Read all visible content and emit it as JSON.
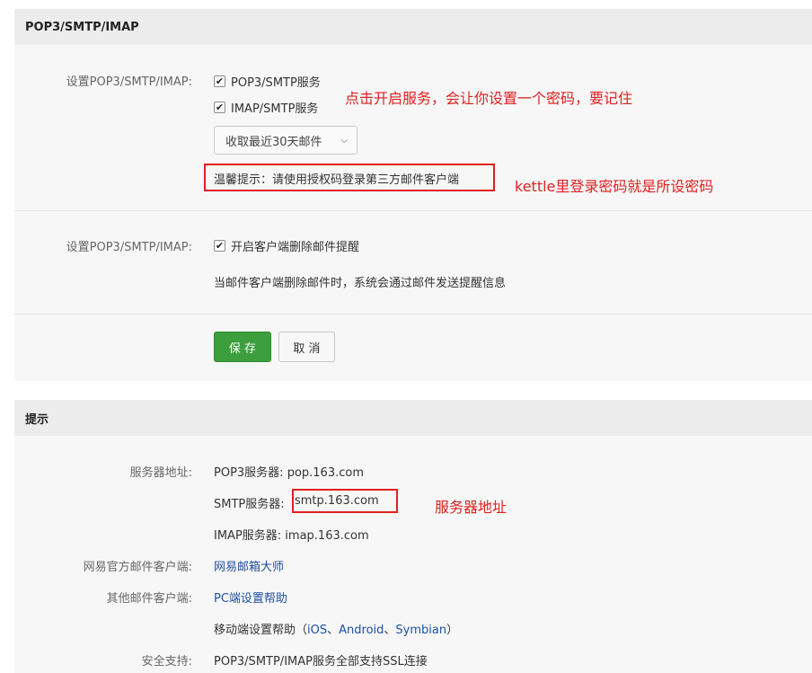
{
  "section1": {
    "title": "POP3/SMTP/IMAP",
    "row1_label": "设置POP3/SMTP/IMAP:",
    "pop3_label": "POP3/SMTP服务",
    "imap_label": "IMAP/SMTP服务",
    "select_value": "收取最近30天邮件",
    "tip_text": "温馨提示：请使用授权码登录第三方邮件客户端",
    "row2_label": "设置POP3/SMTP/IMAP:",
    "delete_alert_label": "开启客户端删除邮件提醒",
    "delete_alert_desc": "当邮件客户端删除邮件时，系统会通过邮件发送提醒信息",
    "save_label": "保 存",
    "cancel_label": "取 消"
  },
  "section2": {
    "title": "提示",
    "server_label": "服务器地址:",
    "pop3_server": "POP3服务器: pop.163.com",
    "smtp_prefix": "SMTP服务器:",
    "smtp_server": "smtp.163.com",
    "imap_server": "IMAP服务器: imap.163.com",
    "official_label": "网易官方邮件客户端:",
    "official_link": "网易邮箱大师",
    "other_label": "其他邮件客户端:",
    "pc_help": "PC端设置帮助",
    "mobile_prefix": "移动端设置帮助（",
    "mobile_ios": "iOS",
    "mobile_sep1": "、",
    "mobile_android": "Android",
    "mobile_sep2": "、",
    "mobile_symbian": "Symbian",
    "mobile_suffix": "）",
    "security_label": "安全支持:",
    "security_text": "POP3/SMTP/IMAP服务全部支持SSL连接"
  },
  "annotations": {
    "enable_note": "点击开启服务，会让你设置一个密码，要记住",
    "kettle_note": "kettle里登录密码就是所设密码",
    "server_note": "服务器地址"
  },
  "colors": {
    "accent_green": "#3c9e3c",
    "annotation_red": "#e02020",
    "link_blue": "#1f4fa3"
  }
}
